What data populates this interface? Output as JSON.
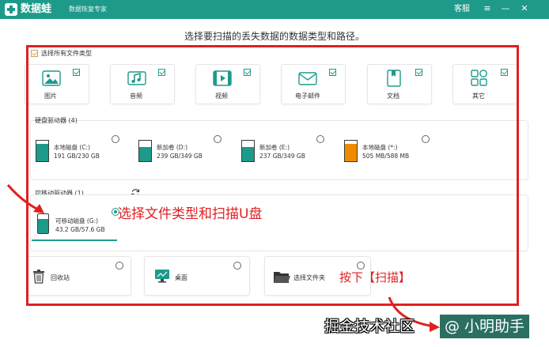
{
  "titlebar": {
    "app_name": "数据蛙",
    "subtitle": "数据恢复专家",
    "service": "客服",
    "menu_glyph": "≡",
    "min_glyph": "—",
    "close_glyph": "✕"
  },
  "headline": "选择要扫描的丢失数据的数据类型和路径。",
  "select_all": {
    "label": "选择所有文件类型",
    "checked": true
  },
  "file_types": [
    {
      "label": "图片",
      "icon": "image-icon",
      "checked": true
    },
    {
      "label": "音频",
      "icon": "audio-icon",
      "checked": true
    },
    {
      "label": "视频",
      "icon": "video-icon",
      "checked": true
    },
    {
      "label": "电子邮件",
      "icon": "email-icon",
      "checked": true
    },
    {
      "label": "文档",
      "icon": "document-icon",
      "checked": true
    },
    {
      "label": "其它",
      "icon": "other-icon",
      "checked": true
    }
  ],
  "hard_drives": {
    "title": "硬盘驱动器 (4)",
    "items": [
      {
        "name": "本地磁盘 (C:)",
        "size": "191 GB/230 GB",
        "fill": 0.83,
        "color": "#1e9a8a",
        "selected": false
      },
      {
        "name": "新加卷 (D:)",
        "size": "239 GB/349 GB",
        "fill": 0.68,
        "color": "#1e9a8a",
        "selected": false
      },
      {
        "name": "新加卷 (E:)",
        "size": "237 GB/349 GB",
        "fill": 0.68,
        "color": "#1e9a8a",
        "selected": false
      },
      {
        "name": "本地磁盘 (*:)",
        "size": "505 MB/588 MB",
        "fill": 0.86,
        "color": "#f08a00",
        "selected": false
      }
    ]
  },
  "removable": {
    "title": "可移动驱动器 (1)",
    "refresh_icon": "refresh-icon",
    "items": [
      {
        "name": "可移动磁盘 (G:)",
        "size": "43.2 GB/57.6 GB",
        "fill": 0.75,
        "color": "#1e9a8a",
        "selected": true
      }
    ]
  },
  "locations": [
    {
      "label": "回收站",
      "icon": "recycle-bin-icon"
    },
    {
      "label": "桌面",
      "icon": "desktop-icon"
    },
    {
      "label": "选择文件夹",
      "icon": "folder-icon"
    }
  ],
  "annotations": {
    "select_hint": "选择文件类型和扫描U盘",
    "scan_hint": "按下【扫描】"
  },
  "watermark": {
    "text": "掘金技术社区",
    "handle": "@ 小明助手"
  },
  "colors": {
    "brand": "#1e9a8a",
    "annotation": "#e02020",
    "checkbox": "#d9a24a",
    "orange_drive": "#f08a00"
  }
}
